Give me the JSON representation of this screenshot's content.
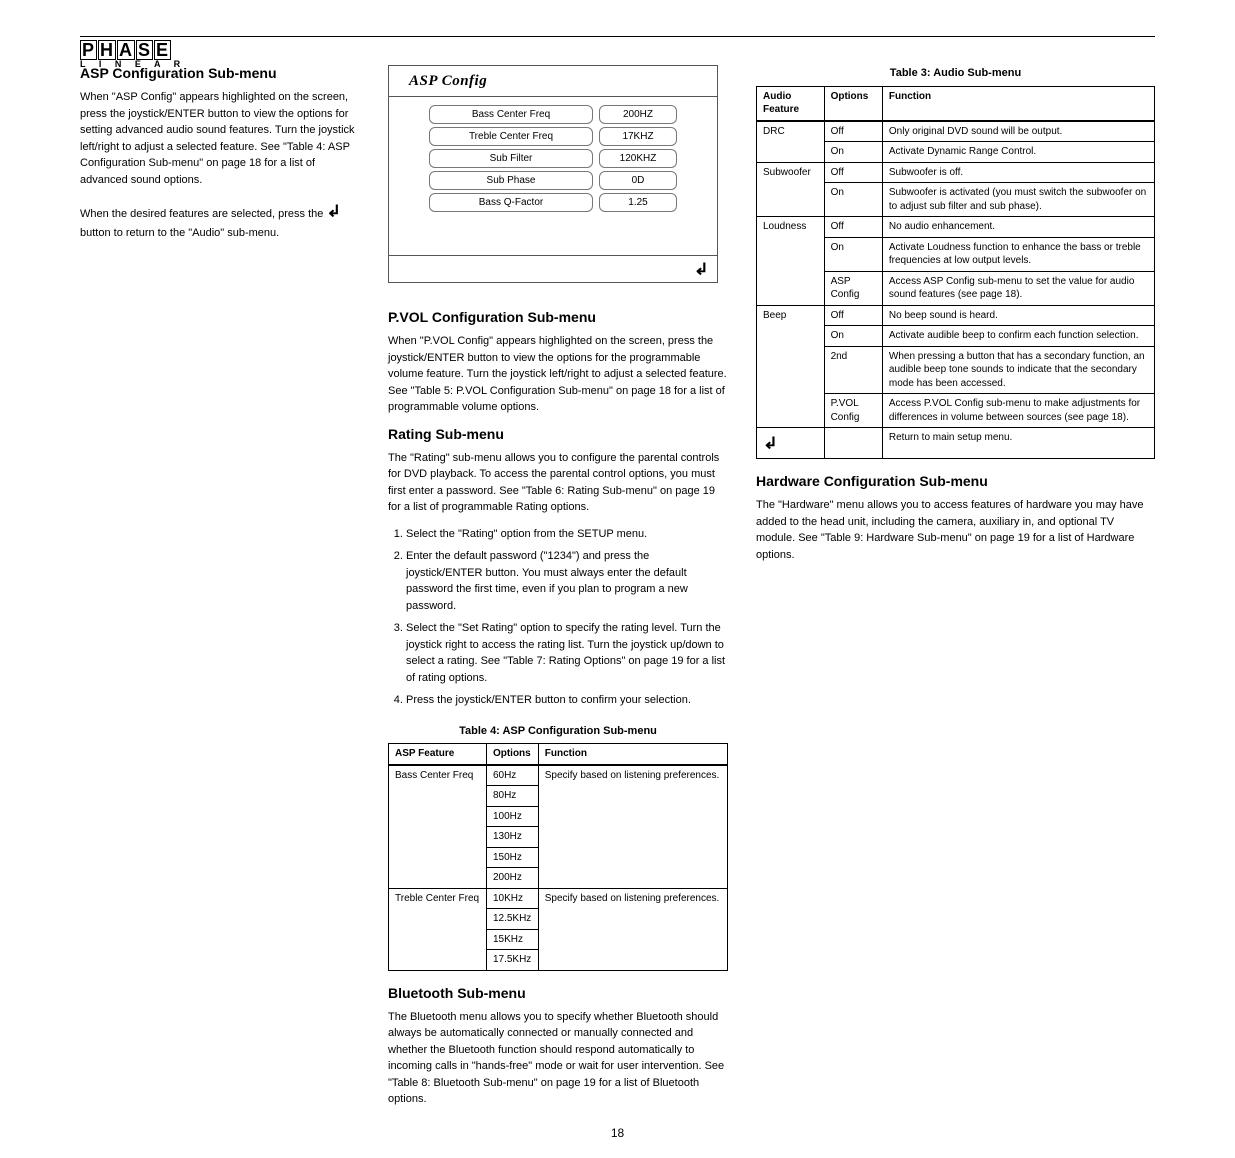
{
  "logo": {
    "row1_chars": [
      "P",
      "H",
      "A",
      "S",
      "E"
    ],
    "row2": "L I N E A R"
  },
  "left": {
    "h1": "ASP Configuration Sub-menu",
    "p1": "When \"ASP Config\" appears highlighted on the screen, press the joystick/ENTER button to view the options for setting advanced audio sound features. Turn the joystick left/right to adjust a selected feature. See \"Table 4: ASP Configuration Sub-menu\" on page 18 for a list of advanced sound options.",
    "p2_a": "When the desired features are selected, press the ",
    "p2_b": " button to return to the \"Audio\" sub-menu."
  },
  "mid": {
    "h1": "P.VOL Configuration Sub-menu",
    "p1": "When \"P.VOL Config\" appears highlighted on the screen, press the joystick/ENTER button to view the options for the programmable volume feature. Turn the joystick left/right to adjust a selected feature. See \"Table 5: P.VOL Configuration Sub-menu\" on page 18 for a list of programmable volume options.",
    "h2": "Rating Sub-menu",
    "p2": "The \"Rating\" sub-menu allows you to configure the parental controls for DVD playback. To access the parental control options, you must first enter a password. See \"Table 6: Rating Sub-menu\" on page 19 for a list of programmable Rating options.",
    "asp_panel": {
      "title": "ASP Config",
      "rows": [
        {
          "label": "Bass Center Freq",
          "value": "200HZ"
        },
        {
          "label": "Treble Center Freq",
          "value": "17KHZ"
        },
        {
          "label": "Sub Filter",
          "value": "120KHZ"
        },
        {
          "label": "Sub Phase",
          "value": "0D"
        },
        {
          "label": "Bass Q-Factor",
          "value": "1.25"
        }
      ]
    },
    "ol": [
      "Select the \"Rating\" option from the SETUP menu.",
      "Enter the default password (\"1234\") and press the joystick/ENTER button. You must always enter the default password the first time, even if you plan to program a new password.",
      "Select the \"Set Rating\" option to specify the rating level. Turn the joystick right to access the rating list. Turn the joystick up/down to select a rating. See \"Table 7: Rating Options\" on page 19 for a list of rating options.",
      "Press the joystick/ENTER button to confirm your selection."
    ],
    "h3": "Bluetooth Sub-menu",
    "p3": "The Bluetooth menu allows you to specify whether Bluetooth should always be automatically connected or manually connected and whether the Bluetooth function should respond automatically to incoming calls in ",
    "p3_cont": "\"hands-free\" mode or wait for user intervention. See \"Table 8: Bluetooth Sub-menu\" on page 19 for a list of Bluetooth options.",
    "h4": "Hardware Configuration Sub-menu",
    "p4": "The \"Hardware\" menu allows you to access features of hardware you may have added to the head unit, including the camera, auxiliary in, and optional TV module. See \"Table 9: Hardware Sub-menu\" on page 19 for a list of Hardware options."
  },
  "right": {
    "t3": {
      "caption": "Table 3: Audio Sub-menu",
      "head": [
        "Audio Feature",
        "Options",
        "Function"
      ],
      "rows": [
        {
          "f": "DRC",
          "o": "Off",
          "d": "Only original DVD sound will be output."
        },
        {
          "f": "",
          "o": "On",
          "d": "Activate Dynamic Range Control."
        },
        {
          "f": "Subwoofer",
          "o": "Off",
          "d": "Subwoofer is off."
        },
        {
          "f": "",
          "o": "On",
          "d": "Subwoofer is activated (you must switch the subwoofer on to adjust sub filter and sub phase)."
        },
        {
          "f": "Loudness",
          "o": "Off",
          "d": "No audio enhancement."
        },
        {
          "f": "",
          "o": "On",
          "d": "Activate Loudness function to enhance the bass or treble frequencies at low output levels."
        },
        {
          "f": "",
          "o": "ASP Config",
          "d": "Access ASP Config sub-menu to set the value for audio sound features (see page 18)."
        },
        {
          "f": "Beep",
          "o": "Off",
          "d": "No beep sound is heard."
        },
        {
          "f": "",
          "o": "On",
          "d": "Activate audible beep to confirm each function selection."
        },
        {
          "f": "",
          "o": "2nd",
          "d": "When pressing a button that has a secondary function, an audible beep tone sounds to indicate that the secondary mode has been accessed."
        },
        {
          "f": "",
          "o": "P.VOL Config",
          "d": "Access P.VOL Config sub-menu to make adjustments for differences in volume between sources (see page 18)."
        },
        {
          "f_icon": "back",
          "o": "",
          "d": "Return to main setup menu."
        }
      ]
    },
    "t4": {
      "caption": "Table 4: ASP Configuration Sub-menu",
      "head": [
        "ASP Feature",
        "Options",
        "Function"
      ],
      "rows": [
        {
          "f": "Bass Center Freq",
          "opts": [
            "60Hz",
            "80Hz",
            "100Hz",
            "130Hz",
            "150Hz",
            "200Hz"
          ],
          "d": "Specify based on listening preferences."
        },
        {
          "f": "Treble Center Freq",
          "opts": [
            "10KHz",
            "12.5KHz",
            "15KHz",
            "17.5KHz"
          ],
          "d": "Specify based on listening preferences."
        }
      ]
    }
  },
  "page_num": "18",
  "chart_data": [
    {
      "type": "table",
      "title": "ASP Config panel values",
      "columns": [
        "Parameter",
        "Value"
      ],
      "rows": [
        [
          "Bass Center Freq",
          "200HZ"
        ],
        [
          "Treble Center Freq",
          "17KHZ"
        ],
        [
          "Sub Filter",
          "120KHZ"
        ],
        [
          "Sub Phase",
          "0D"
        ],
        [
          "Bass Q-Factor",
          "1.25"
        ]
      ]
    },
    {
      "type": "table",
      "title": "Table 3: Audio Sub-menu",
      "columns": [
        "Audio Feature",
        "Options",
        "Function"
      ],
      "rows": [
        [
          "DRC",
          "Off",
          "Only original DVD sound will be output."
        ],
        [
          "DRC",
          "On",
          "Activate Dynamic Range Control."
        ],
        [
          "Subwoofer",
          "Off",
          "Subwoofer is off."
        ],
        [
          "Subwoofer",
          "On",
          "Subwoofer is activated (you must switch the subwoofer on to adjust sub filter and sub phase)."
        ],
        [
          "Loudness",
          "Off",
          "No audio enhancement."
        ],
        [
          "Loudness",
          "On",
          "Activate Loudness function to enhance the bass or treble frequencies at low output levels."
        ],
        [
          "",
          "ASP Config",
          "Access ASP Config sub-menu to set the value for audio sound features (see page 18)."
        ],
        [
          "Beep",
          "Off",
          "No beep sound is heard."
        ],
        [
          "Beep",
          "On",
          "Activate audible beep to confirm each function selection."
        ],
        [
          "Beep",
          "2nd",
          "When pressing a button that has a secondary function, an audible beep tone sounds to indicate that the secondary mode has been accessed."
        ],
        [
          "",
          "P.VOL Config",
          "Access P.VOL Config sub-menu to make adjustments for differences in volume between sources (see page 18)."
        ],
        [
          "(back)",
          "",
          "Return to main setup menu."
        ]
      ]
    },
    {
      "type": "table",
      "title": "Table 4: ASP Configuration Sub-menu",
      "columns": [
        "ASP Feature",
        "Options",
        "Function"
      ],
      "rows": [
        [
          "Bass Center Freq",
          "60Hz",
          "Specify based on listening preferences."
        ],
        [
          "Bass Center Freq",
          "80Hz",
          ""
        ],
        [
          "Bass Center Freq",
          "100Hz",
          ""
        ],
        [
          "Bass Center Freq",
          "130Hz",
          ""
        ],
        [
          "Bass Center Freq",
          "150Hz",
          ""
        ],
        [
          "Bass Center Freq",
          "200Hz",
          ""
        ],
        [
          "Treble Center Freq",
          "10KHz",
          "Specify based on listening preferences."
        ],
        [
          "Treble Center Freq",
          "12.5KHz",
          ""
        ],
        [
          "Treble Center Freq",
          "15KHz",
          ""
        ],
        [
          "Treble Center Freq",
          "17.5KHz",
          ""
        ]
      ]
    }
  ]
}
